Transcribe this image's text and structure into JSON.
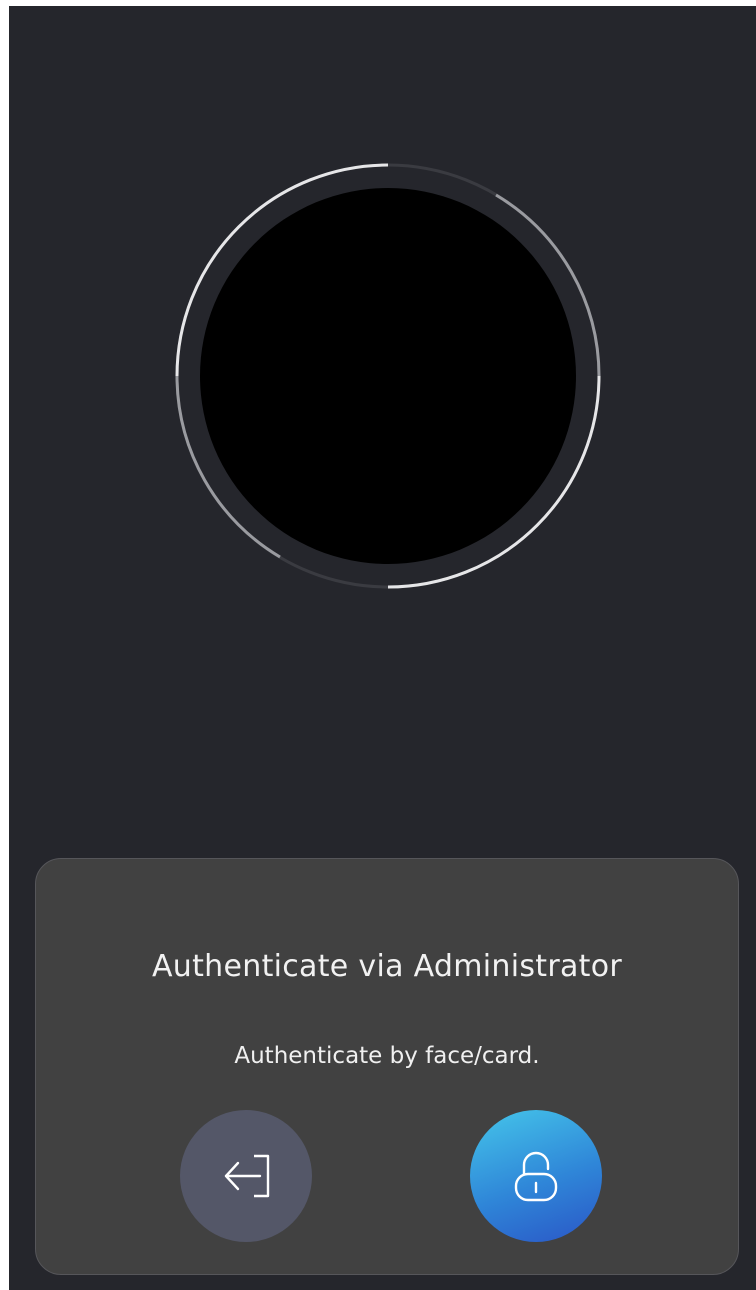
{
  "camera": {
    "ring_progress": 0.5
  },
  "dialog": {
    "title": "Authenticate via Administrator",
    "subtitle": "Authenticate by face/card.",
    "exit_button": {
      "icon": "exit-arrow-icon"
    },
    "unlock_button": {
      "icon": "unlock-icon"
    }
  },
  "colors": {
    "background": "#25262c",
    "panel": "#414141",
    "exit_button": "#545768",
    "unlock_gradient_start": "#45c6ea",
    "unlock_gradient_end": "#2a56c6"
  }
}
